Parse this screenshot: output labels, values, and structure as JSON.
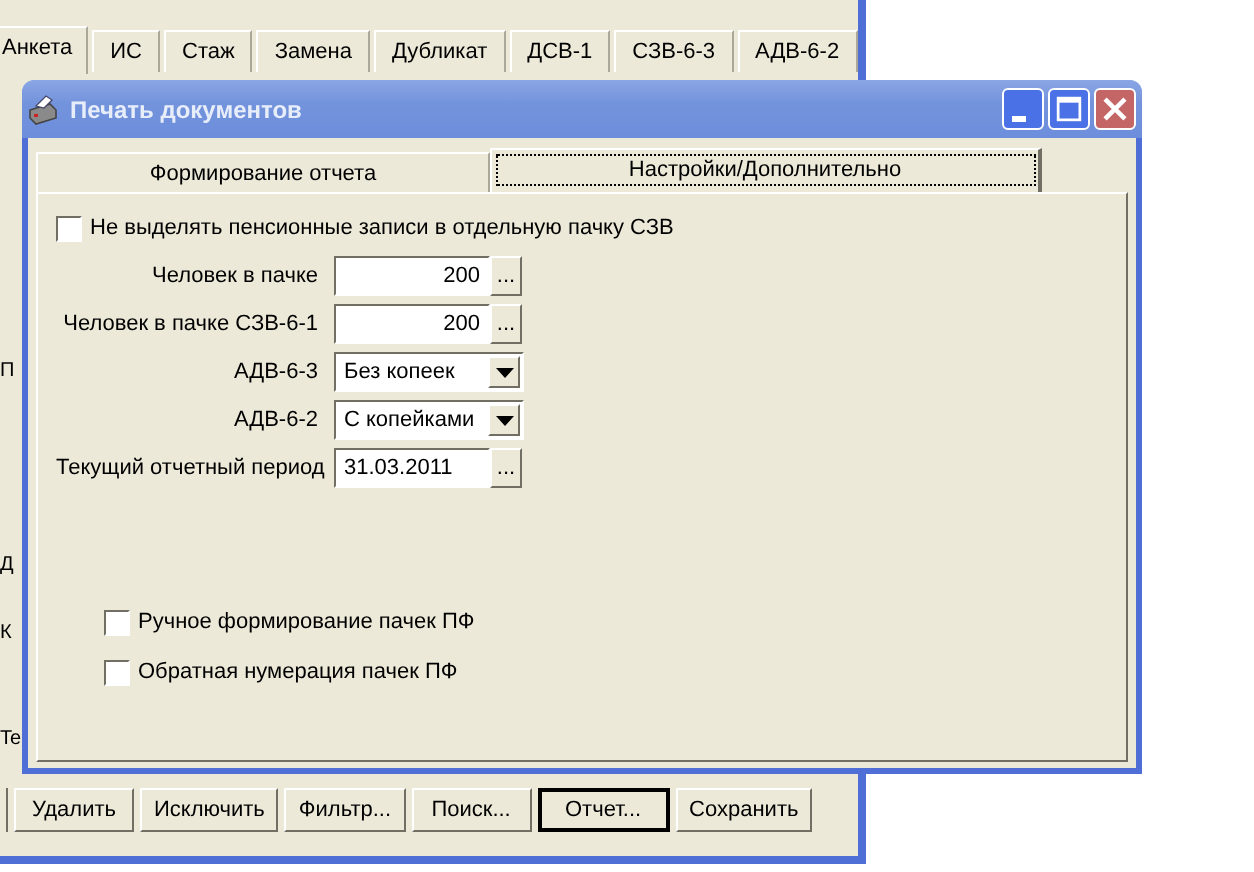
{
  "main_window": {
    "tabs": [
      {
        "label": "Анкета",
        "selected": true
      },
      {
        "label": "ИС",
        "selected": false
      },
      {
        "label": "Стаж",
        "selected": false
      },
      {
        "label": "Замена",
        "selected": false
      },
      {
        "label": "Дубликат",
        "selected": false
      },
      {
        "label": "ДСВ-1",
        "selected": false
      },
      {
        "label": "СЗВ-6-3",
        "selected": false
      },
      {
        "label": "АДВ-6-2",
        "selected": false
      }
    ],
    "edge_labels": [
      "П",
      "Д",
      "К",
      "Те"
    ],
    "buttons": [
      {
        "label": "Удалить",
        "focused": false
      },
      {
        "label": "Исключить",
        "focused": false
      },
      {
        "label": "Фильтр...",
        "focused": false
      },
      {
        "label": "Поиск...",
        "focused": false
      },
      {
        "label": "Отчет...",
        "focused": true
      },
      {
        "label": "Сохранить",
        "focused": false
      }
    ]
  },
  "dialog": {
    "title": "Печать документов",
    "tabs": [
      {
        "label": "Формирование отчета",
        "selected": false
      },
      {
        "label": "Настройки/Дополнительно",
        "selected": true
      }
    ],
    "top_option": {
      "label": "Не выделять пенсионные записи в отдельную пачку СЗВ",
      "checked": false
    },
    "fields": [
      {
        "kind": "number",
        "label": "Человек в пачке",
        "value": "200",
        "button_label": "..."
      },
      {
        "kind": "number",
        "label": "Человек в пачке СЗВ-6-1",
        "value": "200",
        "button_label": "..."
      },
      {
        "kind": "combo",
        "label": "АДВ-6-3",
        "value": "Без копеек"
      },
      {
        "kind": "combo",
        "label": "АДВ-6-2",
        "value": "С копейками"
      },
      {
        "kind": "date",
        "label": "Текущий отчетный период",
        "value": "31.03.2011",
        "button_label": "..."
      }
    ],
    "bottom_options": [
      {
        "label": "Ручное формирование пачек ПФ",
        "checked": false
      },
      {
        "label": "Обратная нумерация пачек ПФ",
        "checked": false
      }
    ]
  }
}
